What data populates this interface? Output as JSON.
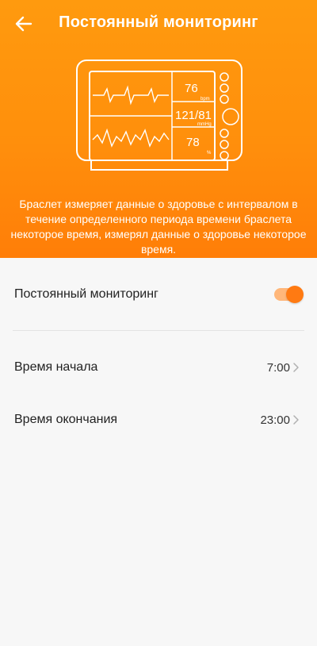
{
  "header": {
    "title": "Постоянный мониторинг",
    "back_icon": "arrow-left-icon",
    "description": "Браслет измеряет данные о здоровье с интервалом в течение определенного периода времени браслета некоторое время, измерял данные о здоровье некоторое время.",
    "gradient_top": "#ff9a0e",
    "gradient_bottom": "#ff7e08"
  },
  "monitor_illustration": {
    "heart_rate": "76",
    "heart_rate_unit": "bpm",
    "blood_pressure": "121/81",
    "blood_pressure_unit": "mmHg",
    "oxygen": "78",
    "oxygen_unit": "%"
  },
  "settings": {
    "continuous_monitoring": {
      "label": "Постоянный мониторинг",
      "enabled": true,
      "accent": "#ff7a12"
    },
    "start_time": {
      "label": "Время начала",
      "value": "7:00"
    },
    "end_time": {
      "label": "Время окончания",
      "value": "23:00"
    }
  }
}
